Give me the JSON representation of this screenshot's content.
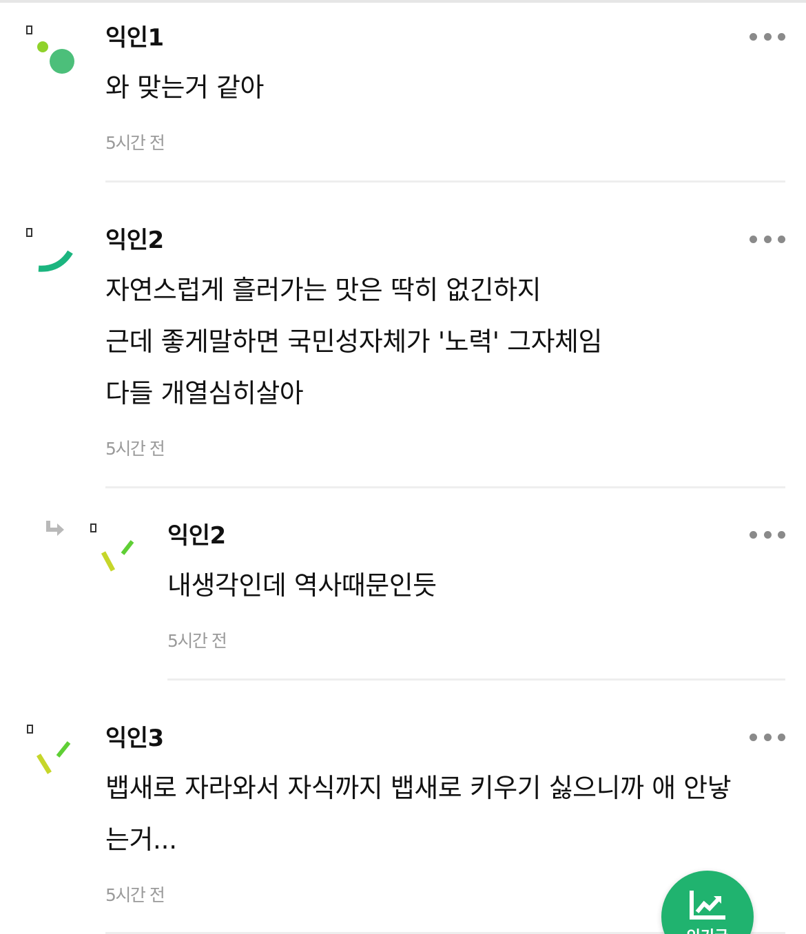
{
  "comments": [
    {
      "author": "익인1",
      "lines": [
        "와 맞는거 같아"
      ],
      "time": "5시간 전",
      "avatar_icon": "dots-avatar-icon",
      "is_reply": false
    },
    {
      "author": "익인2",
      "lines": [
        "자연스럽게 흘러가는 맛은 딱히 없긴하지",
        "근데 좋게말하면 국민성자체가 '노력' 그자체임",
        "다들 개열심히살아"
      ],
      "time": "5시간 전",
      "avatar_icon": "smile-avatar-icon",
      "is_reply": false
    },
    {
      "author": "익인2",
      "lines": [
        "내생각인데 역사때문인듯"
      ],
      "time": "5시간 전",
      "avatar_icon": "dash-avatar-icon",
      "is_reply": true
    },
    {
      "author": "익인3",
      "lines": [
        "뱁새로 자라와서 자식까지 뱁새로 키우기 싫으니까 애 안낳",
        "는거..."
      ],
      "time": "5시간 전",
      "avatar_icon": "dash-avatar-icon",
      "is_reply": false
    }
  ],
  "fab": {
    "label": "인기글",
    "icon": "trending-chart-icon",
    "color": "#20b36f"
  },
  "colors": {
    "author": "#111111",
    "timestamp": "#9a9a9a",
    "divider": "#eeeeee",
    "accent_green": "#20b36f"
  }
}
